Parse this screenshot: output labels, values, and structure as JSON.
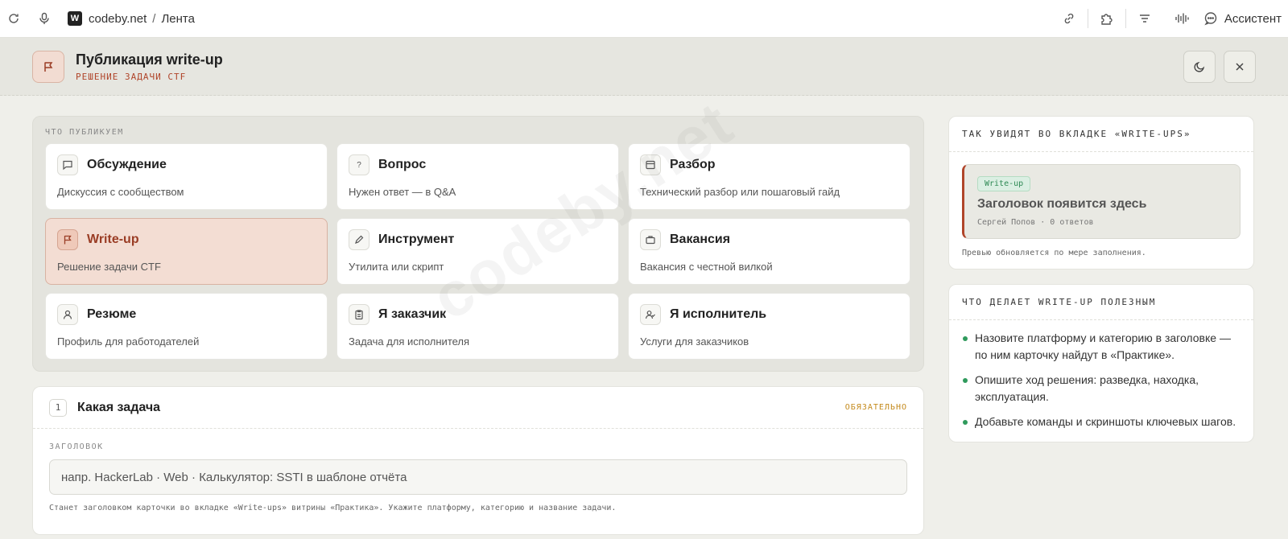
{
  "browser": {
    "site": "codeby.net",
    "separator": "/",
    "page": "Лента",
    "assistant_label": "Ассистент"
  },
  "header": {
    "title": "Публикация write-up",
    "subtitle": "РЕШЕНИЕ ЗАДАЧИ CTF"
  },
  "types": {
    "label": "ЧТО ПУБЛИКУЕМ",
    "items": [
      {
        "name": "Обсуждение",
        "desc": "Дискуссия с сообществом",
        "icon": "chat-icon"
      },
      {
        "name": "Вопрос",
        "desc": "Нужен ответ — в Q&A",
        "icon": "question-icon"
      },
      {
        "name": "Разбор",
        "desc": "Технический разбор или пошаговый гайд",
        "icon": "window-icon"
      },
      {
        "name": "Write-up",
        "desc": "Решение задачи CTF",
        "icon": "flag-icon",
        "selected": true
      },
      {
        "name": "Инструмент",
        "desc": "Утилита или скрипт",
        "icon": "pencil-icon"
      },
      {
        "name": "Вакансия",
        "desc": "Вакансия с честной вилкой",
        "icon": "briefcase-icon"
      },
      {
        "name": "Резюме",
        "desc": "Профиль для работодателей",
        "icon": "user-icon"
      },
      {
        "name": "Я заказчик",
        "desc": "Задача для исполнителя",
        "icon": "clipboard-icon"
      },
      {
        "name": "Я исполнитель",
        "desc": "Услуги для заказчиков",
        "icon": "user-check-icon"
      }
    ]
  },
  "task": {
    "number": "1",
    "title": "Какая задача",
    "required": "ОБЯЗАТЕЛЬНО",
    "field_label": "ЗАГОЛОВОК",
    "placeholder": "напр. HackerLab · Web · Калькулятор: SSTI в шаблоне отчёта",
    "value": "",
    "hint": "Станет заголовком карточки во вкладке «Write-ups» витрины «Практика». Укажите платформу, категорию и название задачи."
  },
  "preview": {
    "heading": "ТАК УВИДЯТ ВО ВКЛАДКЕ «WRITE-UPS»",
    "badge": "Write-up",
    "title": "Заголовок появится здесь",
    "meta": "Сергей Попов · 0 ответов",
    "note": "Превью обновляется по мере заполнения."
  },
  "tips": {
    "heading": "ЧТО ДЕЛАЕТ WRITE-UP ПОЛЕЗНЫМ",
    "items": [
      "Назовите платформу и категорию в заголовке — по ним карточку найдут в «Практике».",
      "Опишите ход решения: разведка, находка, эксплуатация.",
      "Добавьте команды и скриншоты ключевых шагов."
    ]
  },
  "watermark": "codeby.net",
  "colors": {
    "accent": "#b0452a",
    "selected_bg": "#f3ddd3",
    "badge_green": "#2f8a55",
    "required": "#c48a1c",
    "bullet": "#2f9a5c"
  }
}
